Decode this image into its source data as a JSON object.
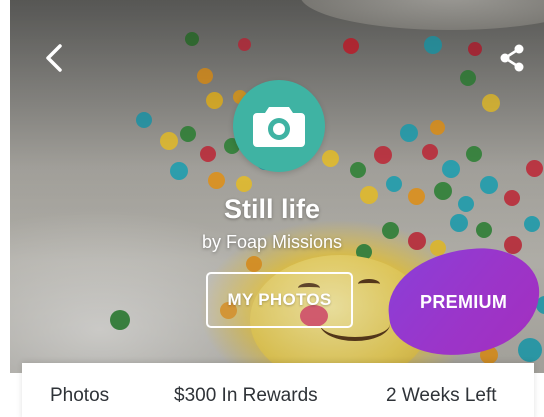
{
  "header": {
    "back_icon": "chevron-left-icon",
    "share_icon": "share-icon"
  },
  "mission": {
    "icon": "camera-icon",
    "badge_color": "#3fb3a3",
    "title": "Still life",
    "subtitle": "by Foap Missions"
  },
  "actions": {
    "my_photos_label": "MY PHOTOS",
    "premium_label": "PREMIUM",
    "premium_color": "#9b35c9"
  },
  "stats": {
    "photos": "Photos",
    "rewards": "$300 In Rewards",
    "time_left": "2 Weeks Left"
  }
}
